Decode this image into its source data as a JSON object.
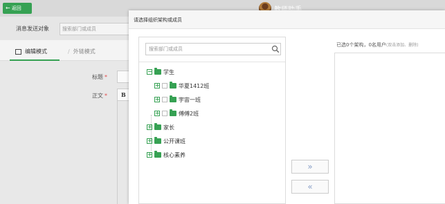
{
  "topbar": {
    "back_label": "返回",
    "app_title": "教师助手"
  },
  "page": {
    "recipient_label": "消息发送对象",
    "recipient_placeholder": "搜索部门或成员",
    "mode_edit": "编辑模式",
    "mode_link": "外链模式",
    "title_label": "标题",
    "body_label": "正文",
    "required_mark": "*",
    "editor_bold": "B"
  },
  "modal": {
    "title": "请选择组织架构或成员",
    "search_placeholder": "搜索部门或成员",
    "tree": [
      {
        "label": "学生",
        "toggle": "−",
        "expanded": true
      },
      {
        "label": "华夏1412班",
        "toggle": "+"
      },
      {
        "label": "宇宙一班",
        "toggle": "+"
      },
      {
        "label": "傅傅2班",
        "toggle": "+"
      },
      {
        "label": "家长",
        "toggle": "+"
      },
      {
        "label": "公开课班",
        "toggle": "+"
      },
      {
        "label": "核心素养",
        "toggle": "+"
      }
    ],
    "add_button": "»",
    "remove_button": "«",
    "selected_summary": "已选0个架构，0名用户",
    "selected_hint": "(双击添加、删除)"
  },
  "colors": {
    "accent": "#36a153",
    "topbar": "#d9d9d9"
  }
}
